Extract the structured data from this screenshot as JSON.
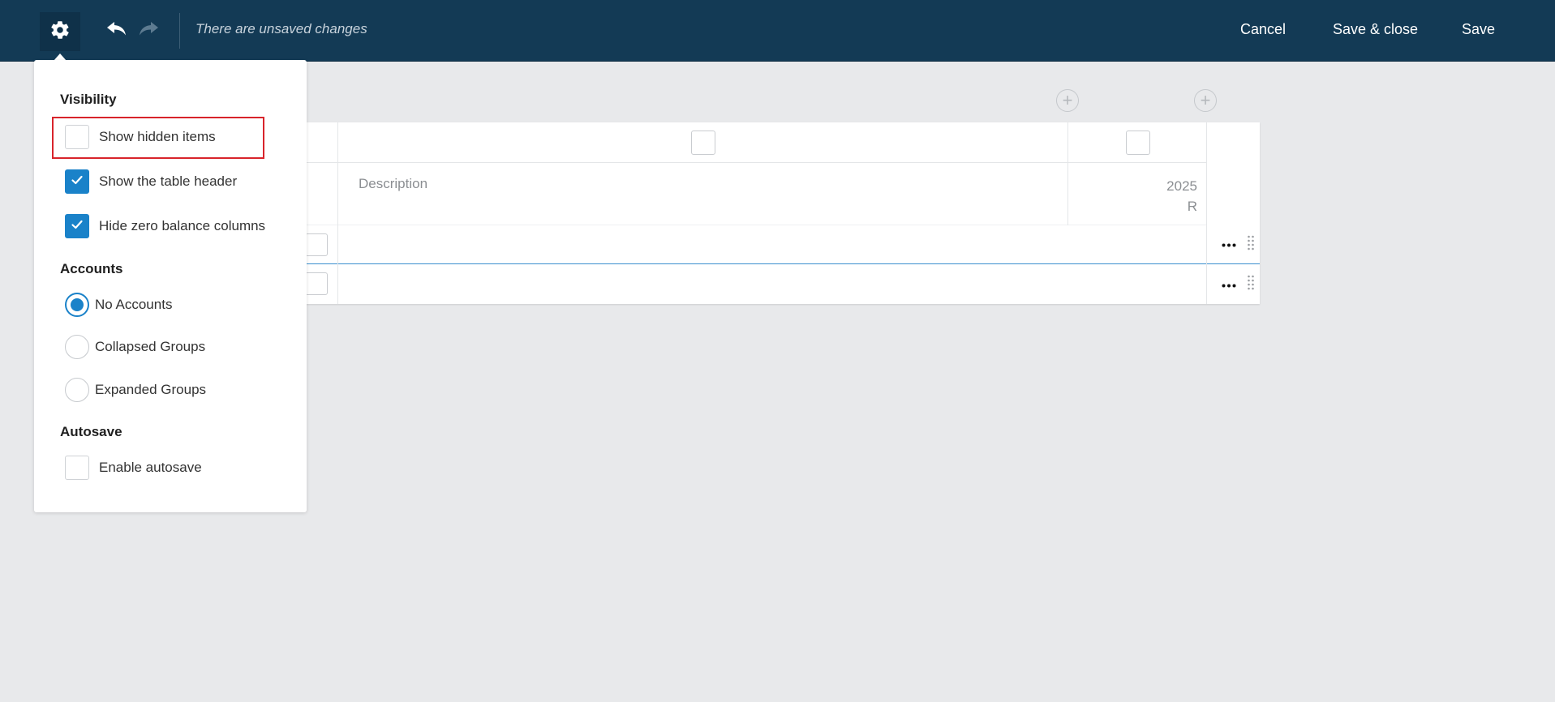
{
  "toolbar": {
    "settings_icon": "gear-icon",
    "undo_icon": "undo-icon",
    "redo_icon": "redo-icon",
    "status_text": "There are unsaved changes",
    "cancel_label": "Cancel",
    "save_close_label": "Save & close",
    "save_label": "Save",
    "background_color": "#133a55"
  },
  "table": {
    "columns": [
      {
        "header": "Description"
      },
      {
        "header_line1": "2025",
        "header_line2": "R"
      }
    ],
    "rows": [
      {
        "description": "",
        "value": ""
      },
      {
        "description": "",
        "value": ""
      }
    ],
    "row_actions_icon": "more-horizontal-icon",
    "drag_icon": "drag-handle-icon",
    "add_column_icon": "plus-circle-icon"
  },
  "settings": {
    "visibility": {
      "title": "Visibility",
      "options": [
        {
          "label": "Show hidden items",
          "checked": false,
          "highlighted": true
        },
        {
          "label": "Show the table header",
          "checked": true
        },
        {
          "label": "Hide zero balance columns",
          "checked": true
        }
      ]
    },
    "accounts": {
      "title": "Accounts",
      "options": [
        {
          "label": "No Accounts",
          "selected": true
        },
        {
          "label": "Collapsed Groups",
          "selected": false
        },
        {
          "label": "Expanded Groups",
          "selected": false
        }
      ]
    },
    "autosave": {
      "title": "Autosave",
      "options": [
        {
          "label": "Enable autosave",
          "checked": false
        }
      ]
    },
    "accent_color": "#1a82c9",
    "highlight_color": "#d8242b"
  }
}
